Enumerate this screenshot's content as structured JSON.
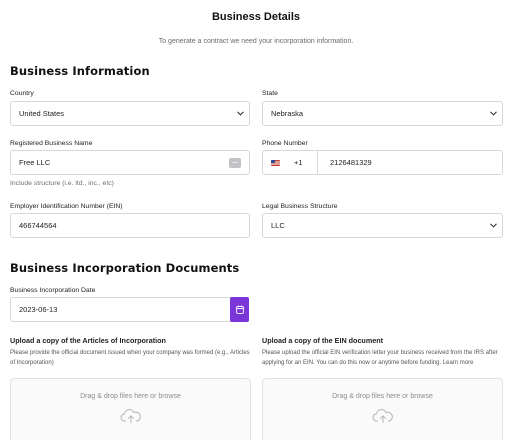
{
  "page": {
    "title": "Business Details",
    "subtitle": "To generate a contract we need your incorporation information."
  },
  "business_information": {
    "heading": "Business Information",
    "country": {
      "label": "Country",
      "value": "United States"
    },
    "state": {
      "label": "State",
      "value": "Nebraska"
    },
    "business_name": {
      "label": "Registered Business Name",
      "value": "Free LLC",
      "hint": "Include structure (i.e. ltd., inc., etc)"
    },
    "phone": {
      "label": "Phone Number",
      "dial_code": "+1",
      "value": "2126481329",
      "flag_icon": "us-flag-icon"
    },
    "ein": {
      "label": "Employer Identification Number (EIN)",
      "value": "466744564"
    },
    "legal_structure": {
      "label": "Legal Business Structure",
      "value": "LLC"
    }
  },
  "incorporation_documents": {
    "heading": "Business Incorporation Documents",
    "incorporation_date": {
      "label": "Business Incorporation Date",
      "value": "2023-06-13",
      "button_icon": "calendar-icon",
      "button_color": "#7a36d6"
    },
    "articles_upload": {
      "title": "Upload a copy of the Articles of Incorporation",
      "description": "Please provide the official document issued when your company was formed (e.g., Articles of Incorporation)",
      "dropzone_text": "Drag & drop files here or browse",
      "icon": "cloud-upload-icon"
    },
    "ein_upload": {
      "title": "Upload a copy of the EIN document",
      "description": "Please upload the official EIN verification letter your business received from the IRS after applying for an EIN. You can do this now or anytime before funding. Learn more",
      "dropzone_text": "Drag & drop files here or browse",
      "icon": "cloud-upload-icon"
    }
  }
}
